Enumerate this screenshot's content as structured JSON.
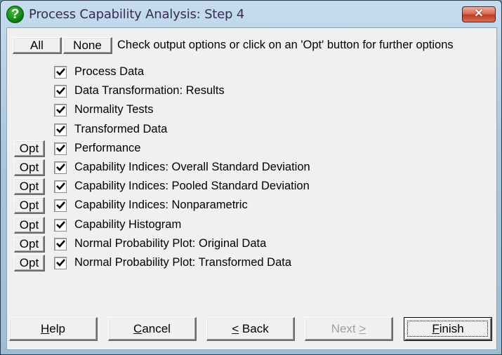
{
  "window": {
    "title": "Process Capability Analysis: Step 4",
    "title_icon": "help-question-icon",
    "close_glyph": "✕"
  },
  "toolbar": {
    "all_label": "All",
    "none_label": "None",
    "instruction": "Check output options or click on an 'Opt' button for further options"
  },
  "options": [
    {
      "label": "Process Data",
      "checked": true,
      "has_opt": false
    },
    {
      "label": "Data Transformation: Results",
      "checked": true,
      "has_opt": false
    },
    {
      "label": "Normality Tests",
      "checked": true,
      "has_opt": false
    },
    {
      "label": "Transformed Data",
      "checked": true,
      "has_opt": false
    },
    {
      "label": "Performance",
      "checked": true,
      "has_opt": true
    },
    {
      "label": "Capability Indices: Overall Standard Deviation",
      "checked": true,
      "has_opt": true
    },
    {
      "label": "Capability Indices: Pooled Standard Deviation",
      "checked": true,
      "has_opt": true
    },
    {
      "label": "Capability Indices: Nonparametric",
      "checked": true,
      "has_opt": true
    },
    {
      "label": "Capability Histogram",
      "checked": true,
      "has_opt": true
    },
    {
      "label": "Normal Probability Plot: Original Data",
      "checked": true,
      "has_opt": true
    },
    {
      "label": "Normal Probability Plot: Transformed Data",
      "checked": true,
      "has_opt": true
    }
  ],
  "opt_label": "Opt",
  "footer": {
    "help": {
      "mnemonic": "H",
      "rest": "elp"
    },
    "cancel": {
      "mnemonic": "C",
      "rest": "ancel"
    },
    "back": {
      "prefix": "",
      "mnemonic": "<",
      "rest": " Back"
    },
    "next": {
      "prefix": "Next ",
      "mnemonic": ">",
      "rest": "",
      "disabled": true
    },
    "finish": {
      "mnemonic": "F",
      "rest": "inish",
      "default": true
    }
  }
}
